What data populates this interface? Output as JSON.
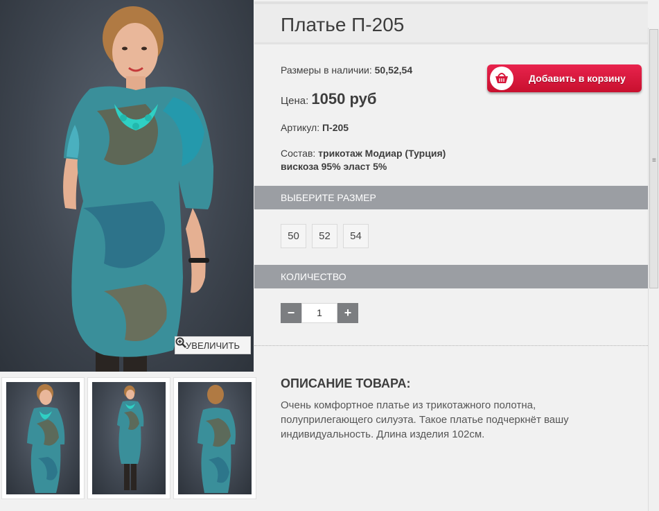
{
  "product": {
    "title": "Платье П-205",
    "sizes_label": "Размеры в наличии:",
    "sizes_value": "50,52,54",
    "price_label": "Цена:",
    "price_value": "1050 руб",
    "article_label": "Артикул:",
    "article_value": "П-205",
    "composition_label": "Состав:",
    "composition_line1": "трикотаж Модиар (Турция)",
    "composition_line2": "вискоза 95% эласт 5%"
  },
  "cart_button": {
    "label": "Добавить в корзину",
    "icon": "basket-icon"
  },
  "zoom_button": {
    "label": "УВЕЛИЧИТЬ",
    "icon": "zoom-in-icon"
  },
  "size_section": {
    "title": "ВЫБЕРИТЕ РАЗМЕР",
    "options": [
      "50",
      "52",
      "54"
    ]
  },
  "quantity_section": {
    "title": "КОЛИЧЕСТВО",
    "minus": "−",
    "value": "1",
    "plus": "+"
  },
  "description": {
    "title": "ОПИСАНИЕ ТОВАРА:",
    "text": "Очень комфортное платье из трикотажного полотна, полуприлегающего силуэта. Такое платье подчеркнёт вашу индивидуальность. Длина изделия 102см."
  },
  "colors": {
    "cart_button": "#d8173c",
    "section_bar": "#9b9ea3",
    "qty_button": "#7c7e81",
    "photo_background": "#3f4650"
  }
}
